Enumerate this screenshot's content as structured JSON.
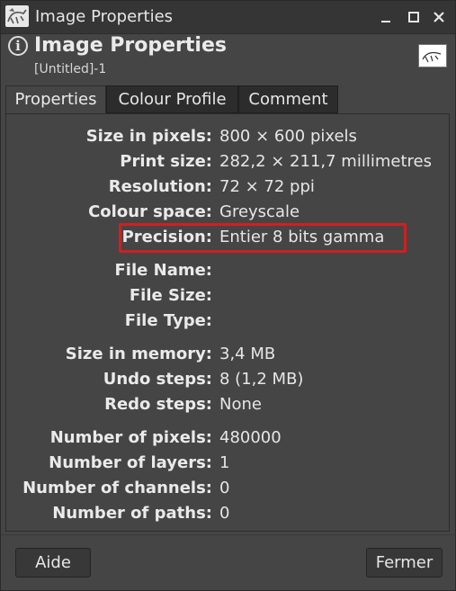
{
  "window": {
    "title": "Image Properties",
    "icons": {
      "app": "gimp-wilber-icon",
      "minimize": "minimize-icon",
      "maximize": "maximize-icon",
      "close": "close-icon"
    }
  },
  "header": {
    "title": "Image Properties",
    "subtitle": "[Untitled]-1",
    "icon": "info-icon"
  },
  "tabs": [
    {
      "label": "Properties",
      "active": true
    },
    {
      "label": "Colour Profile",
      "active": false
    },
    {
      "label": "Comment",
      "active": false
    }
  ],
  "properties": [
    {
      "label": "Size in pixels:",
      "value": "800 × 600 pixels"
    },
    {
      "label": "Print size:",
      "value": "282,2 × 211,7 millimetres"
    },
    {
      "label": "Resolution:",
      "value": "72 × 72 ppi"
    },
    {
      "label": "Colour space:",
      "value": "Greyscale"
    },
    {
      "label": "Precision:",
      "value": "Entier 8 bits gamma"
    },
    {
      "label": "File Name:",
      "value": ""
    },
    {
      "label": "File Size:",
      "value": ""
    },
    {
      "label": "File Type:",
      "value": ""
    },
    {
      "label": "Size in memory:",
      "value": "3,4 MB"
    },
    {
      "label": "Undo steps:",
      "value": "8 (1,2 MB)"
    },
    {
      "label": "Redo steps:",
      "value": "None"
    },
    {
      "label": "Number of pixels:",
      "value": "480000"
    },
    {
      "label": "Number of layers:",
      "value": "1"
    },
    {
      "label": "Number of channels:",
      "value": "0"
    },
    {
      "label": "Number of paths:",
      "value": "0"
    }
  ],
  "highlight_color": "#d11f1f",
  "buttons": {
    "help": "Aide",
    "close": "Fermer"
  }
}
